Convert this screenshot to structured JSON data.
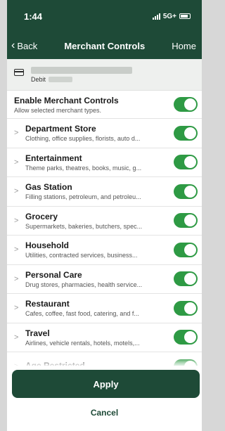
{
  "status": {
    "time": "1:44",
    "network": "5G+"
  },
  "nav": {
    "back_label": "Back",
    "title": "Merchant Controls",
    "home_label": "Home"
  },
  "account": {
    "type_label": "Debit"
  },
  "master": {
    "title": "Enable Merchant Controls",
    "subtitle": "Allow selected merchant types.",
    "enabled": true
  },
  "categories": [
    {
      "title": "Department Store",
      "subtitle": "Clothing, office supplies, florists, auto d...",
      "enabled": true
    },
    {
      "title": "Entertainment",
      "subtitle": "Theme parks, theatres, books, music, g...",
      "enabled": true
    },
    {
      "title": "Gas Station",
      "subtitle": "Filling stations, petroleum, and petroleu...",
      "enabled": true
    },
    {
      "title": "Grocery",
      "subtitle": "Supermarkets, bakeries, butchers, spec...",
      "enabled": true
    },
    {
      "title": "Household",
      "subtitle": "Utilities, contracted services, business...",
      "enabled": true
    },
    {
      "title": "Personal Care",
      "subtitle": "Drug stores, pharmacies, health service...",
      "enabled": true
    },
    {
      "title": "Restaurant",
      "subtitle": "Cafes, coffee, fast food, catering, and f...",
      "enabled": true
    },
    {
      "title": "Travel",
      "subtitle": "Airlines, vehicle rentals, hotels, motels,...",
      "enabled": true
    },
    {
      "title": "Age Restricted",
      "subtitle": "",
      "enabled": true
    }
  ],
  "buttons": {
    "apply_label": "Apply",
    "cancel_label": "Cancel"
  },
  "colors": {
    "brand_green": "#1e4a37",
    "toggle_on": "#2e9a44"
  }
}
